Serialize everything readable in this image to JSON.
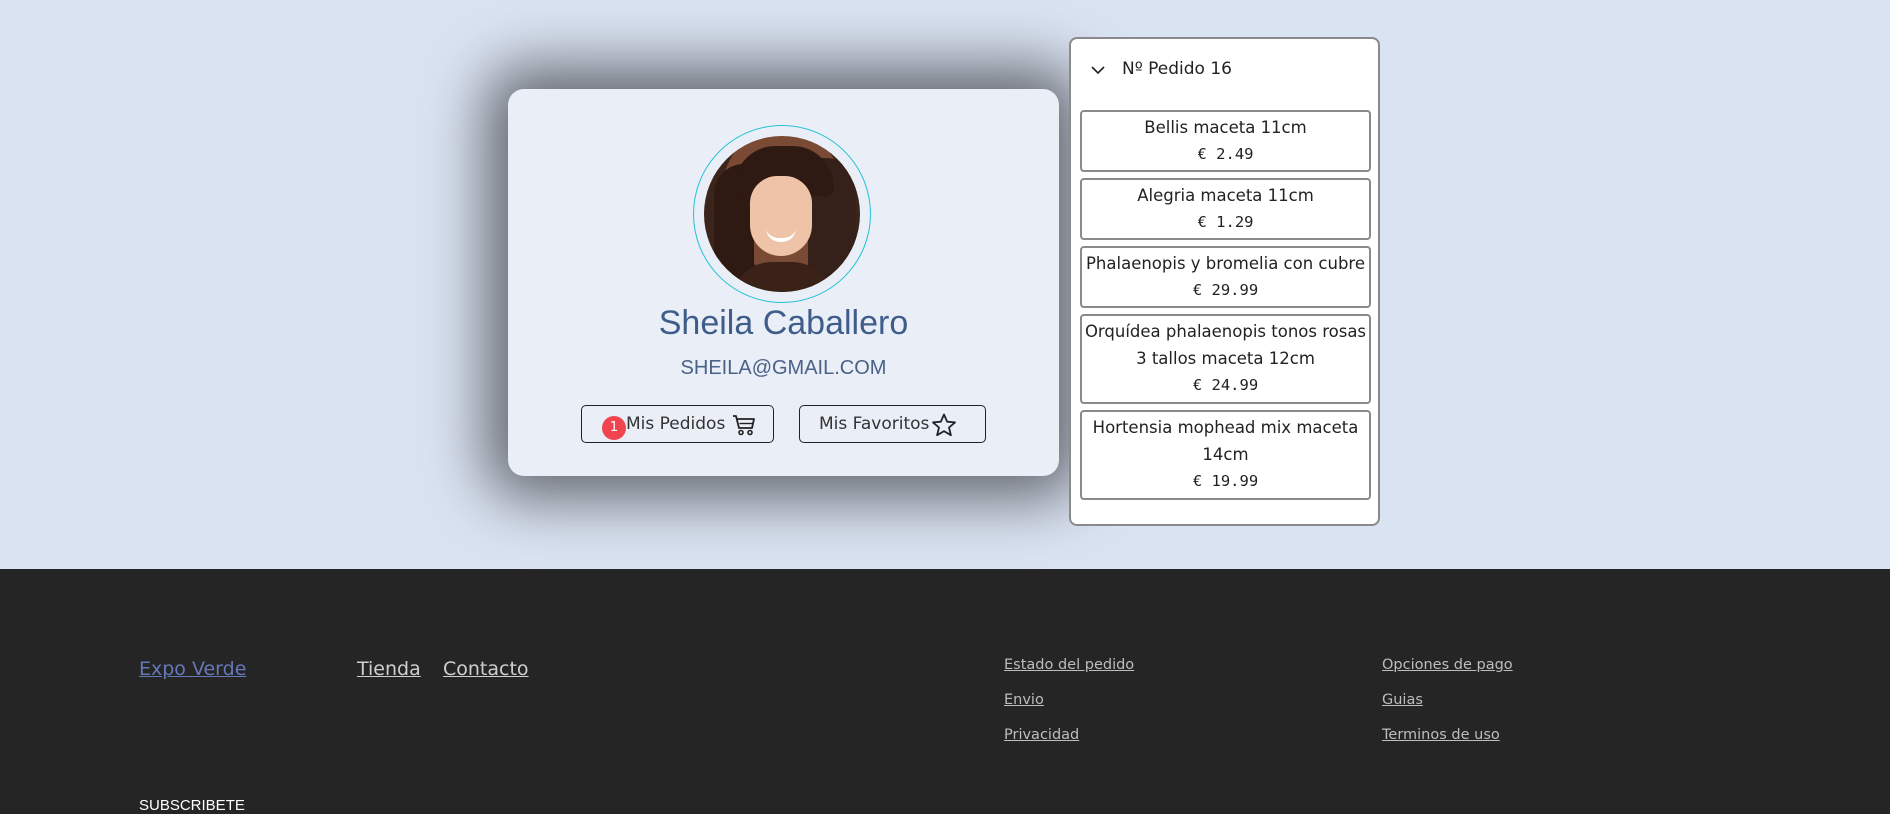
{
  "profile": {
    "name": "Sheila Caballero",
    "email": "SHEILA@GMAIL.COM",
    "orders_button": {
      "label": "Mis Pedidos",
      "badge": "1",
      "icon": "cart-icon"
    },
    "favorites_button": {
      "label": "Mis Favoritos",
      "icon": "star-icon"
    }
  },
  "order": {
    "title": "Nº Pedido 16",
    "expanded": true,
    "items": [
      {
        "name": "Bellis maceta 11cm",
        "price": "€ 2.49"
      },
      {
        "name": "Alegria maceta 11cm",
        "price": "€ 1.29"
      },
      {
        "name": "Phalaenopis y bromelia con cubre",
        "price": "€ 29.99"
      },
      {
        "name": "Orquídea phalaenopis tonos rosas 3 tallos maceta 12cm",
        "price": "€ 24.99"
      },
      {
        "name": "Hortensia mophead mix maceta 14cm",
        "price": "€ 19.99"
      }
    ]
  },
  "footer": {
    "brand": "Expo Verde",
    "nav": [
      "Tienda",
      "Contacto"
    ],
    "col1": [
      "Estado del pedido",
      "Envio",
      "Privacidad"
    ],
    "col2": [
      "Opciones de pago",
      "Guias",
      "Terminos de uso"
    ],
    "subscribe": "SUBSCRIBETE"
  },
  "colors": {
    "page_bg": "#dae3f2",
    "card_bg": "#e9eef7",
    "name_color": "#3f5d8a",
    "badge": "#f0454f",
    "footer_bg": "#252525",
    "brand_link": "#6578b8"
  }
}
